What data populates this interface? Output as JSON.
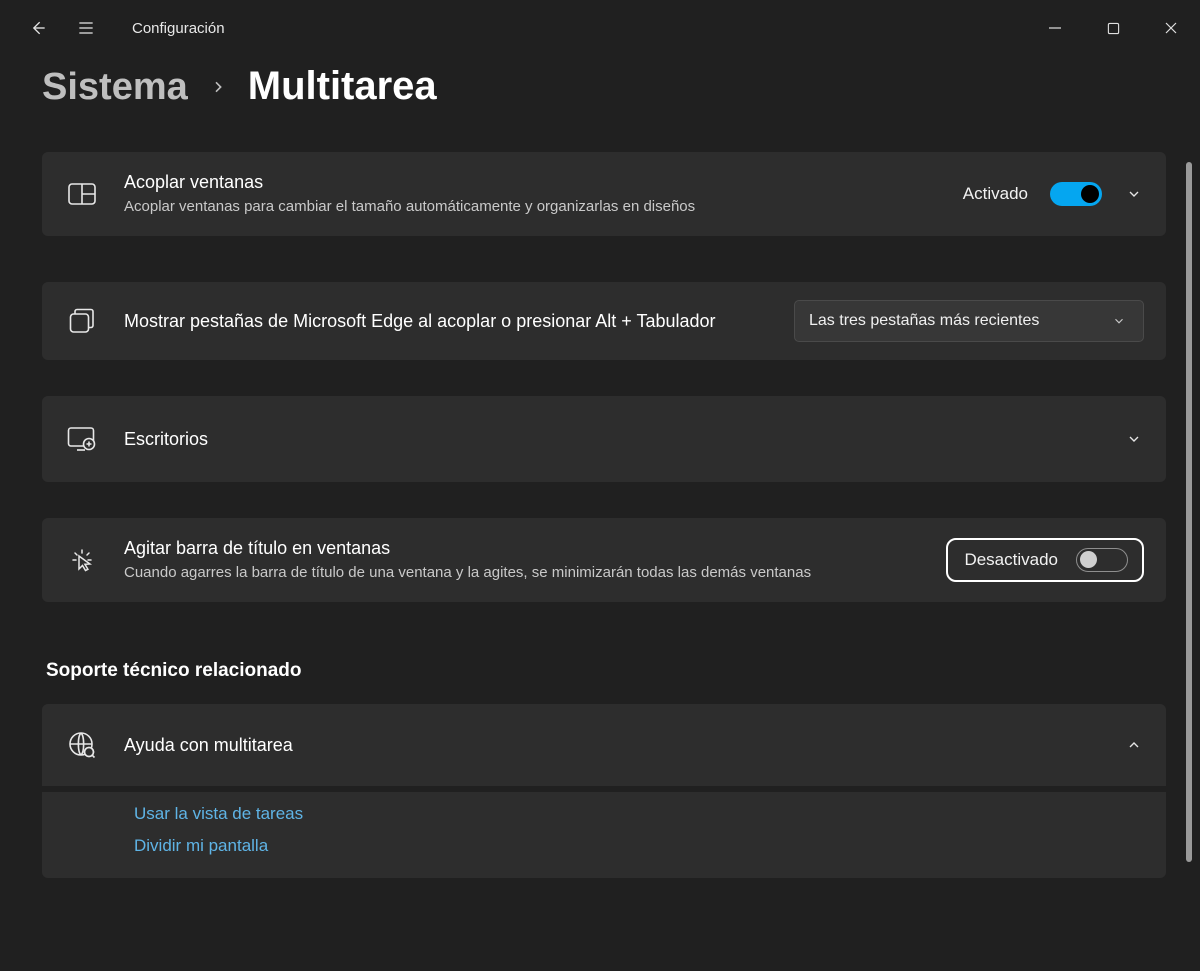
{
  "titlebar": {
    "title": "Configuración"
  },
  "breadcrumb": {
    "parent": "Sistema",
    "current": "Multitarea"
  },
  "cards": {
    "snap": {
      "title": "Acoplar ventanas",
      "desc": "Acoplar ventanas para cambiar el tamaño automáticamente y organizarlas en diseños",
      "state_label": "Activado"
    },
    "edge_tabs": {
      "title": "Mostrar pestañas de Microsoft Edge al acoplar o presionar Alt + Tabulador",
      "dropdown_value": "Las tres pestañas más recientes"
    },
    "desktops": {
      "title": "Escritorios"
    },
    "shake": {
      "title": "Agitar barra de título en ventanas",
      "desc": "Cuando agarres la barra de título de una ventana y la agites, se minimizarán todas las demás ventanas",
      "state_label": "Desactivado"
    }
  },
  "support": {
    "heading": "Soporte técnico relacionado",
    "help_title": "Ayuda con multitarea",
    "links": {
      "task_view": "Usar la vista de tareas",
      "split": "Dividir mi pantalla"
    }
  }
}
